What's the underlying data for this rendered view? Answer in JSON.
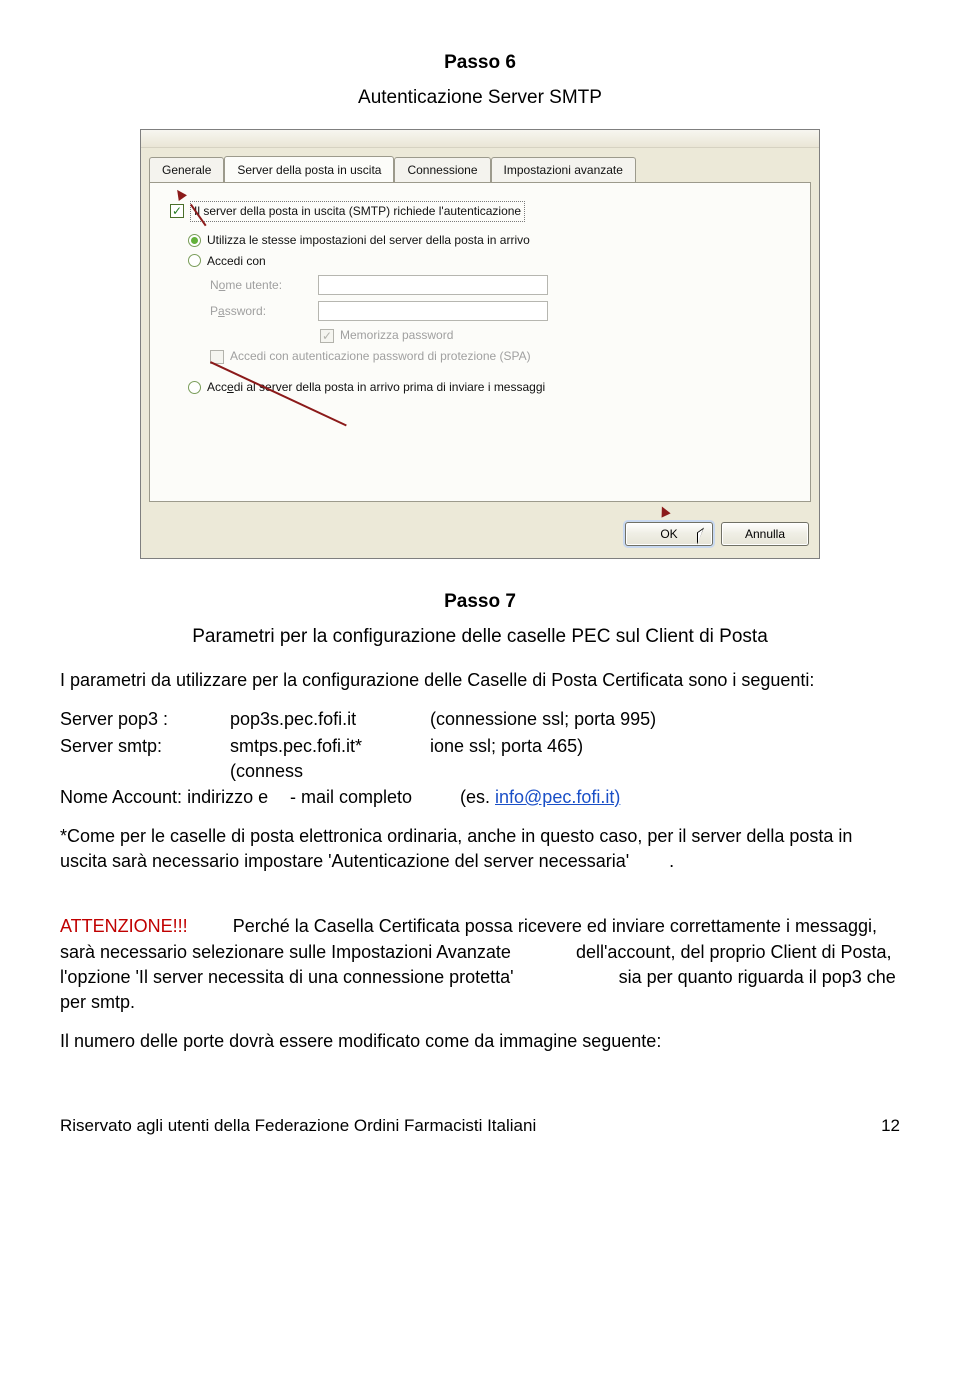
{
  "step6": {
    "title": "Passo 6",
    "sub": "Autenticazione Server SMTP"
  },
  "dialog": {
    "tabs": [
      "Generale",
      "Server della posta in uscita",
      "Connessione",
      "Impostazioni avanzate"
    ],
    "chk_main": "Il server della posta in uscita (SMTP) richiede l'autenticazione",
    "radio1": "Utilizza le stesse impostazioni del server della posta in arrivo",
    "radio2": "Accedi con",
    "lbl_user_pre": "N",
    "lbl_user_u": "o",
    "lbl_user_post": "me utente:",
    "lbl_pass_pre": "P",
    "lbl_pass_u": "a",
    "lbl_pass_post": "ssword:",
    "chk_mem": "Memorizza password",
    "chk_spa": "Accedi con autenticazione password di protezione (SPA)",
    "radio3_pre": "Acc",
    "radio3_u": "e",
    "radio3_post": "di al server della posta in arrivo prima di inviare i messaggi",
    "btn_ok": "OK",
    "btn_cancel": "Annulla"
  },
  "step7": {
    "title": "Passo 7",
    "sub": "Parametri per la configurazione delle caselle PEC sul Client di Posta"
  },
  "intro": "I parametri da utilizzare per la configurazione delle Caselle di Posta Certificata sono i seguenti:",
  "table": {
    "r1c1": "Server pop3 :",
    "r1c2": "pop3s.pec.fofi.it",
    "r1c3": "(connessione ssl; porta 995)",
    "r2c1": "Server smtp:",
    "r2c2": "smtps.pec.fofi.it* (conness",
    "r2c3": "ione ssl; porta 465)",
    "r3c1": "Nome Account: indirizzo e",
    "r3c2": "- mail completo",
    "r3c3a": "(es. ",
    "r3link": "info@pec.fofi.it)"
  },
  "note": {
    "pre": "*Come per le caselle di posta elettronica ordinaria, anche in questo caso, per il server della posta in uscita sarà necessario impostare ",
    "q": "'Autenticazione del server necessaria'",
    "post": "."
  },
  "att": {
    "label": "ATTENZIONE!!!",
    "t1": "Perché la Casella Certificata possa ricevere ed inviare correttamente i messaggi, sarà necessario selezionare sulle ",
    "imp": "Impostazioni Avanzate",
    "t2": " dell'account, del proprio Client di Posta, l'opzione ",
    "opt": "'Il server necessita di una connessione protetta'",
    "t3": " sia per quanto riguarda il ",
    "p3": "pop3",
    "t4": " che per ",
    "sm": "smtp."
  },
  "closing": "Il numero delle porte dovrà essere modificato come da immagine seguente:",
  "footer": {
    "left": "Riservato agli utenti della Federazione Ordini Farmacisti Italiani",
    "page": "12"
  }
}
